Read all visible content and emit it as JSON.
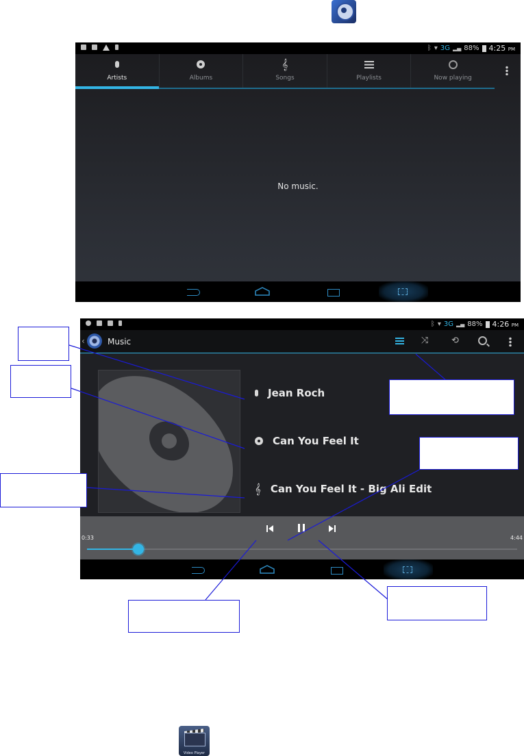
{
  "screen1": {
    "status": {
      "network": "3G",
      "battery": "88%",
      "time": "4:25",
      "ampm": "PM"
    },
    "tabs": [
      {
        "label": "Artists",
        "icon": "mic-icon",
        "selected": true
      },
      {
        "label": "Albums",
        "icon": "album-disc-icon",
        "selected": false
      },
      {
        "label": "Songs",
        "icon": "treble-clef-icon",
        "selected": false
      },
      {
        "label": "Playlists",
        "icon": "playlist-icon",
        "selected": false
      },
      {
        "label": "Now playing",
        "icon": "now-playing-icon",
        "selected": false
      }
    ],
    "empty_message": "No music."
  },
  "screen2": {
    "status": {
      "network": "3G",
      "battery": "88%",
      "time": "4:26",
      "ampm": "PM"
    },
    "action_bar": {
      "back": "‹",
      "title": "Music",
      "actions": [
        "list-icon",
        "shuffle-icon",
        "repeat-icon",
        "search-icon",
        "overflow-menu-icon"
      ]
    },
    "track": {
      "artist": "Jean Roch",
      "album": "Can You Feel It",
      "song": "Can You Feel It - Big Ali Edit"
    },
    "playback": {
      "position": "0:33",
      "duration": "4:44",
      "progress_percent": 12
    }
  },
  "colors": {
    "accent": "#33b5e5",
    "callout_line": "#1a1ad8"
  },
  "app_icons": {
    "video_player_label": "Video Player"
  }
}
